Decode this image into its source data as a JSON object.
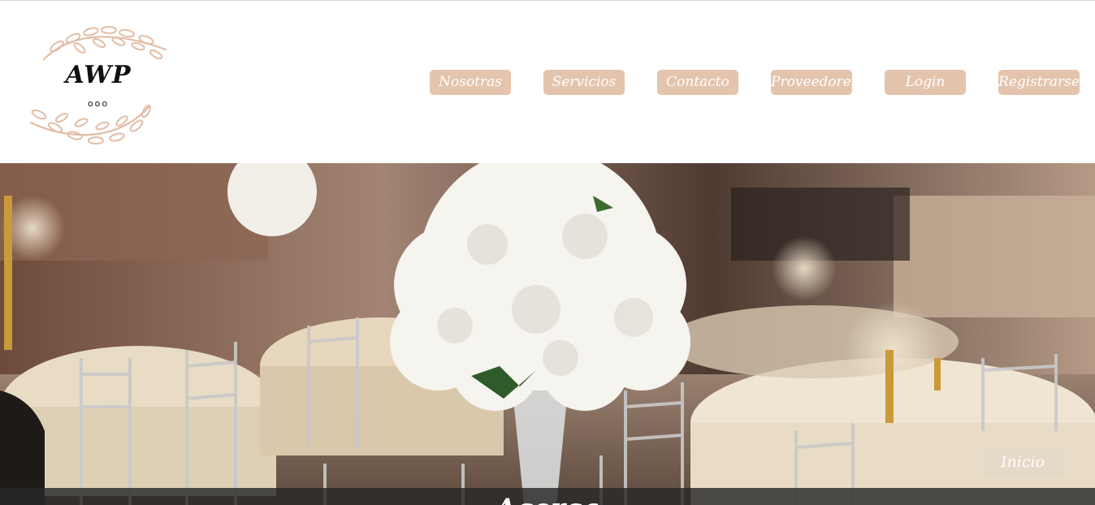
{
  "logo": {
    "text": "AWP",
    "dots": "ooo"
  },
  "nav": {
    "nosotras": "Nosotras",
    "servicios": "Servicios",
    "contacto": "Contacto",
    "proveedores": "Proveedores",
    "login": "Login",
    "registrarse": "Registrarse"
  },
  "hero": {
    "inicio_label": "Inicio",
    "caption": "Acerca"
  },
  "colors": {
    "accent": "#e4c4ad",
    "nav_text": "#ffffff",
    "caption_bar": "#282828"
  }
}
